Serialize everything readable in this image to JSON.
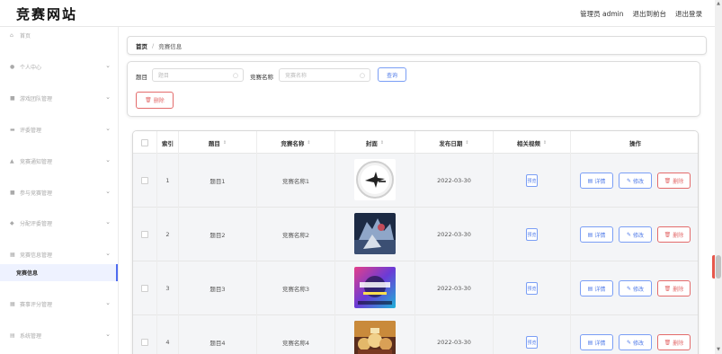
{
  "header": {
    "logo": "竞赛网站",
    "admin": "管理员 admin",
    "back_front": "退出到前台",
    "logout": "退出登录"
  },
  "sidebar": {
    "items": [
      {
        "label": "首页",
        "icon": "home-icon",
        "glyph": "⌂",
        "has_children": false,
        "active": false
      },
      {
        "label": "个人中心",
        "icon": "user-icon",
        "glyph": "●",
        "has_children": true,
        "active": false
      },
      {
        "label": "游戏团队管理",
        "icon": "team-icon",
        "glyph": "■",
        "has_children": true,
        "active": false
      },
      {
        "label": "评委管理",
        "icon": "judge-icon",
        "glyph": "▬",
        "has_children": true,
        "active": false
      },
      {
        "label": "竞赛通知管理",
        "icon": "notice-icon",
        "glyph": "▲",
        "has_children": true,
        "active": false
      },
      {
        "label": "参与竞赛管理",
        "icon": "participate-icon",
        "glyph": "■",
        "has_children": true,
        "active": false
      },
      {
        "label": "分配评委管理",
        "icon": "assign-icon",
        "glyph": "◆",
        "has_children": true,
        "active": false
      },
      {
        "label": "竞赛信息管理",
        "icon": "info-icon",
        "glyph": "▦",
        "has_children": true,
        "active": false
      },
      {
        "label": "竞赛信息",
        "icon": "",
        "glyph": "",
        "has_children": false,
        "active": true
      },
      {
        "label": "赛事评分管理",
        "icon": "score-icon",
        "glyph": "▦",
        "has_children": true,
        "active": false
      },
      {
        "label": "系统管理",
        "icon": "system-icon",
        "glyph": "▤",
        "has_children": true,
        "active": false
      }
    ]
  },
  "breadcrumb": {
    "home": "首页",
    "separator": "/",
    "current": "竞赛信息"
  },
  "search": {
    "topic_label": "题目",
    "topic_placeholder": "题目",
    "name_label": "竞赛名称",
    "name_placeholder": "竞赛名称",
    "query_button": "查询",
    "delete_button": "删除"
  },
  "table": {
    "columns": {
      "index": "索引",
      "topic": "题目",
      "name": "竞赛名称",
      "cover": "封面",
      "date": "发布日期",
      "video": "相关视频",
      "actions": "操作"
    },
    "sort_glyph": "⇕",
    "rows": [
      {
        "index": "1",
        "topic": "题目1",
        "name": "竞赛名称1",
        "date": "2022-03-30",
        "video": "预览",
        "cover_kind": "logo"
      },
      {
        "index": "2",
        "topic": "题目2",
        "name": "竞赛名称2",
        "date": "2022-03-30",
        "video": "预览",
        "cover_kind": "monster"
      },
      {
        "index": "3",
        "topic": "题目3",
        "name": "竞赛名称3",
        "date": "2022-03-30",
        "video": "预览",
        "cover_kind": "match"
      },
      {
        "index": "4",
        "topic": "题目4",
        "name": "竞赛名称4",
        "date": "2022-03-30",
        "video": "预览",
        "cover_kind": "heroes"
      }
    ],
    "actions": {
      "detail": "详情",
      "edit": "修改",
      "delete": "删除"
    }
  },
  "colors": {
    "primary": "#4f7ae8",
    "danger": "#e36b6b",
    "active_bg": "#eef2ff"
  }
}
